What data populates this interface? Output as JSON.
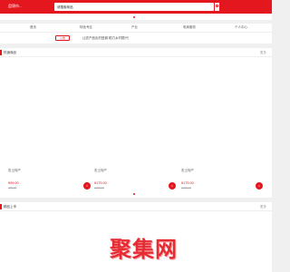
{
  "header": {
    "logo_text": "盘锦市...",
    "search": {
      "value": "请搜索商品"
    }
  },
  "nav": {
    "items": [
      {
        "label": "首页"
      },
      {
        "label": "特色专区"
      },
      {
        "label": "产业"
      },
      {
        "label": "电商服务"
      },
      {
        "label": "个人中心"
      }
    ]
  },
  "notice": {
    "tag": "公告",
    "text": "让农产品出村进城 助力乡村振兴！"
  },
  "panel_products": {
    "title": "热销商品",
    "more": "更多",
    "items": [
      {
        "name": "农土特产",
        "price": "¥99.00",
        "orig": "¥99.00"
      },
      {
        "name": "农土特产",
        "price": "¥175.00",
        "orig": "¥175.00"
      },
      {
        "name": "农土特产",
        "price": "¥175.00",
        "orig": "¥175.00"
      }
    ]
  },
  "panel_second": {
    "title": "精品上市",
    "more": "更多"
  },
  "watermark": "聚集网",
  "colors": {
    "brand": "#e4161e",
    "background": "#f0f0f0"
  }
}
